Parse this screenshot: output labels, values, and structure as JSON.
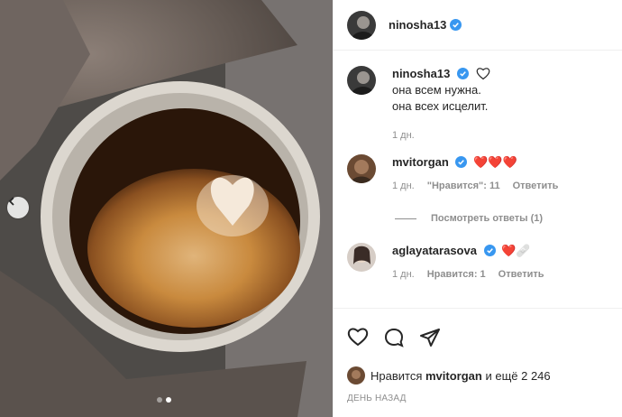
{
  "post": {
    "author": "ninosha13",
    "caption_line1": "она всем нужна.",
    "caption_line2": "она всех исцелит.",
    "caption_age": "1 дн."
  },
  "comments": [
    {
      "user": "mvitorgan",
      "text": "❤️❤️❤️",
      "age": "1 дн.",
      "likes": "\"Нравится\": 11",
      "reply": "Ответить"
    },
    {
      "user": "aglayatarasova",
      "text": "❤️🩹",
      "age": "1 дн.",
      "likes": "Нравится: 1",
      "reply": "Ответить"
    }
  ],
  "view_replies": "Посмотреть ответы (1)",
  "likes_bar": {
    "prefix": "Нравится",
    "user": "mvitorgan",
    "suffix": "и ещё 2 246"
  },
  "posted": "ДЕНЬ НАЗАД",
  "carousel": {
    "total": 2,
    "active": 2
  },
  "colors": {
    "verified": "#3897f0",
    "heart": "#ed4956"
  }
}
